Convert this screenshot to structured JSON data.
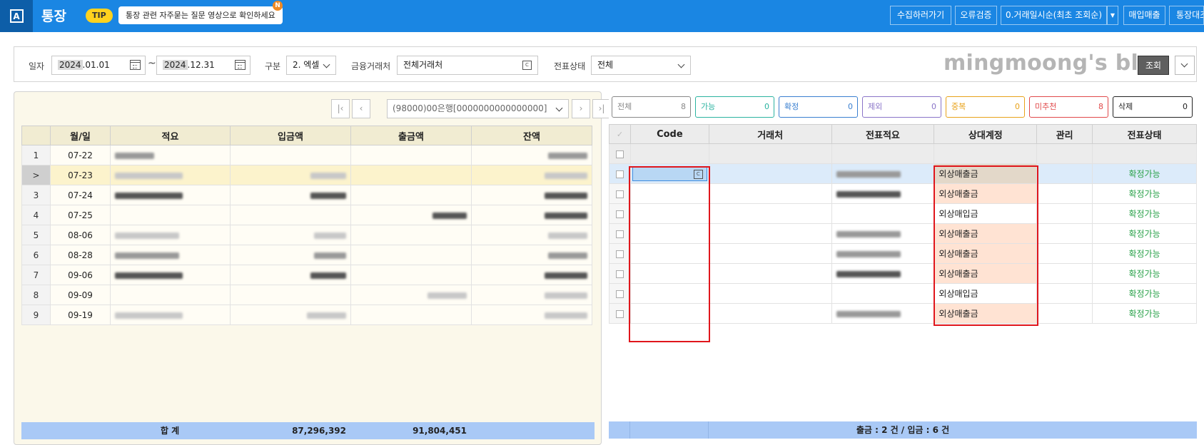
{
  "header": {
    "logo": "A",
    "title": "통장",
    "tip_badge": "TIP",
    "tip_text": "통장 관련 자주묻는 질문 영상으로 확인하세요",
    "tip_new": "N",
    "buttons": {
      "collect": "수집하러가기",
      "error_check": "오류검증",
      "sort": "0.거래일시순(최초 조회순)",
      "sales": "매입매출",
      "bank_compare": "통장대조"
    }
  },
  "filters": {
    "date_label": "일자",
    "date_from_year": "2024",
    "date_from_rest": ".01.01",
    "date_to_year": "2024",
    "date_to_rest": ".12.31",
    "tilde": "~",
    "type_label": "구분",
    "type_value": "2. 엑셀",
    "institution_label": "금융거래처",
    "institution_value": "전체거래처",
    "slip_status_label": "전표상태",
    "slip_status_value": "전체",
    "watermark": "mingmoong's blog",
    "query_button": "조회"
  },
  "left_panel": {
    "account_select": "(98000)00은행[0000000000000000]",
    "nav": {
      "first": "|‹",
      "prev": "‹",
      "next": "›",
      "last": "›|"
    },
    "columns": [
      "월/일",
      "적요",
      "입금액",
      "출금액",
      "잔액"
    ],
    "rows": [
      {
        "no": "1",
        "date": "07-22"
      },
      {
        "no": ">",
        "date": "07-23"
      },
      {
        "no": "3",
        "date": "07-24"
      },
      {
        "no": "4",
        "date": "07-25"
      },
      {
        "no": "5",
        "date": "08-06"
      },
      {
        "no": "6",
        "date": "08-28"
      },
      {
        "no": "7",
        "date": "09-06"
      },
      {
        "no": "8",
        "date": "09-09"
      },
      {
        "no": "9",
        "date": "09-19"
      }
    ],
    "footer": {
      "label": "합    계",
      "deposit_total": "87,296,392",
      "withdraw_total": "91,804,451"
    }
  },
  "right_panel": {
    "filters": [
      {
        "label": "전체",
        "count": "8",
        "color": "#888888"
      },
      {
        "label": "가능",
        "count": "0",
        "color": "#2bb3a0"
      },
      {
        "label": "확정",
        "count": "0",
        "color": "#3a7fd0"
      },
      {
        "label": "제외",
        "count": "0",
        "color": "#8a74c8"
      },
      {
        "label": "중복",
        "count": "0",
        "color": "#e8a21a"
      },
      {
        "label": "미추천",
        "count": "8",
        "color": "#e0494a"
      },
      {
        "label": "삭제",
        "count": "0",
        "color": "#222222"
      }
    ],
    "columns": [
      "Code",
      "거래처",
      "전표적요",
      "상대계정",
      "관리",
      "전표상태"
    ],
    "rows": [
      {
        "account": "외상매출금",
        "status": "확정가능"
      },
      {
        "account": "외상매출금",
        "status": "확정가능"
      },
      {
        "account": "외상매입금",
        "status": "확정가능"
      },
      {
        "account": "외상매출금",
        "status": "확정가능"
      },
      {
        "account": "외상매출금",
        "status": "확정가능"
      },
      {
        "account": "외상매출금",
        "status": "확정가능"
      },
      {
        "account": "외상매입금",
        "status": "확정가능"
      },
      {
        "account": "외상매출금",
        "status": "확정가능"
      }
    ],
    "footer": "출금 : 2 건 / 입금 : 6 건"
  },
  "colors": {
    "topbar": "#1a86e3",
    "accent_red": "#e0161c",
    "status_green": "#2aa24a",
    "footer_blue": "#a9c9f6"
  }
}
